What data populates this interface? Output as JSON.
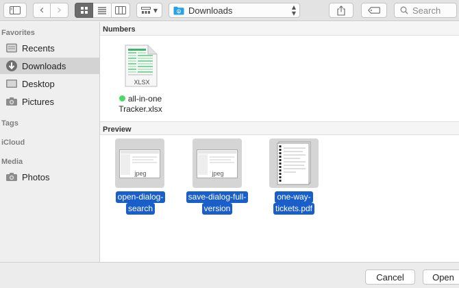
{
  "toolbar": {
    "path_label": "Downloads",
    "search_placeholder": "Search"
  },
  "sidebar": {
    "sections": {
      "favorites": "Favorites",
      "tags": "Tags",
      "icloud": "iCloud",
      "media": "Media"
    },
    "items": [
      {
        "label": "Recents",
        "icon": "clock-icon"
      },
      {
        "label": "Downloads",
        "icon": "download-icon",
        "active": true
      },
      {
        "label": "Desktop",
        "icon": "desktop-icon"
      },
      {
        "label": "Pictures",
        "icon": "camera-icon"
      },
      {
        "label": "Photos",
        "icon": "camera-icon"
      }
    ]
  },
  "groups": [
    {
      "title": "Numbers",
      "files": [
        {
          "name_line1": "all-in-one",
          "name_line2": "Tracker.xlsx",
          "badge": "XLSX",
          "tag_color": "#4cd964"
        }
      ]
    },
    {
      "title": "Preview",
      "files": [
        {
          "name_line1": "open-dialog-",
          "name_line2": "search",
          "badge": "jpeg"
        },
        {
          "name_line1": "save-dialog-full-",
          "name_line2": "version",
          "badge": "jpeg"
        },
        {
          "name_line1": "one-way-",
          "name_line2": "tickets.pdf"
        }
      ]
    }
  ],
  "footer": {
    "cancel_label": "Cancel",
    "open_label": "Open"
  },
  "colors": {
    "selection": "#1a5fc9",
    "folder_blue": "#27a0e8",
    "tag_green": "#4cd964"
  }
}
